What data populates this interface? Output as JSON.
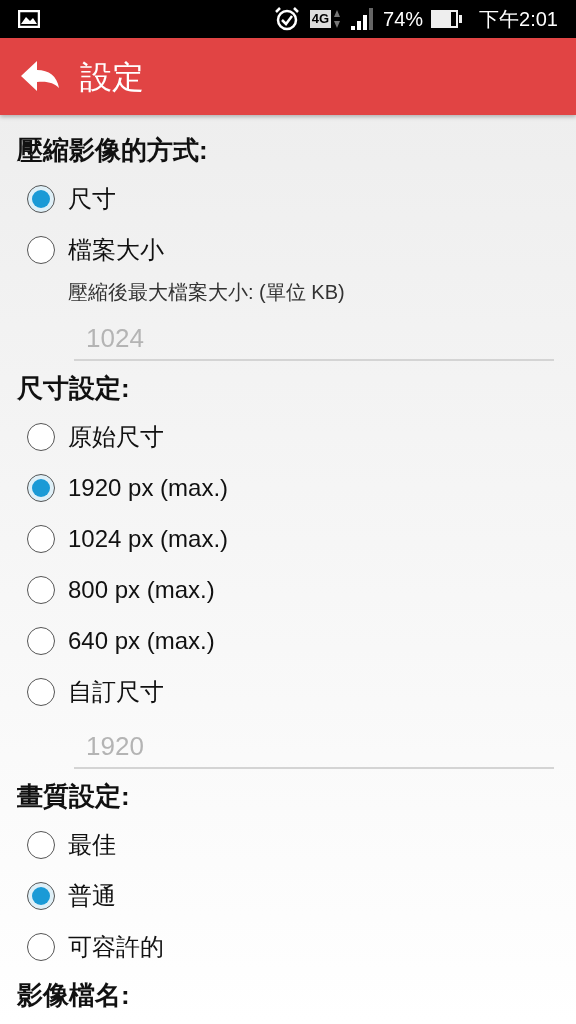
{
  "status_bar": {
    "network": "4G",
    "battery": "74%",
    "time": "下午2:01"
  },
  "app_bar": {
    "title": "設定"
  },
  "sections": [
    {
      "heading": "壓縮影像的方式:",
      "items": [
        {
          "kind": "radio",
          "label": "尺寸",
          "selected": true
        },
        {
          "kind": "radio",
          "label": "檔案大小",
          "selected": false
        },
        {
          "kind": "note",
          "text": "壓縮後最大檔案大小: (單位 KB)"
        },
        {
          "kind": "field",
          "placeholder": "1024"
        }
      ]
    },
    {
      "heading": "尺寸設定:",
      "items": [
        {
          "kind": "radio",
          "label": "原始尺寸",
          "selected": false
        },
        {
          "kind": "radio",
          "label": "1920 px (max.)",
          "selected": true
        },
        {
          "kind": "radio",
          "label": "1024 px (max.)",
          "selected": false
        },
        {
          "kind": "radio",
          "label": "800 px (max.)",
          "selected": false
        },
        {
          "kind": "radio",
          "label": "640 px (max.)",
          "selected": false
        },
        {
          "kind": "radio",
          "label": "自訂尺寸",
          "selected": false
        },
        {
          "kind": "field",
          "placeholder": "1920"
        }
      ]
    },
    {
      "heading": "畫質設定:",
      "items": [
        {
          "kind": "radio",
          "label": "最佳",
          "selected": false
        },
        {
          "kind": "radio",
          "label": "普通",
          "selected": true
        },
        {
          "kind": "radio",
          "label": "可容許的",
          "selected": false
        }
      ]
    },
    {
      "heading": "影像檔名:"
    }
  ]
}
